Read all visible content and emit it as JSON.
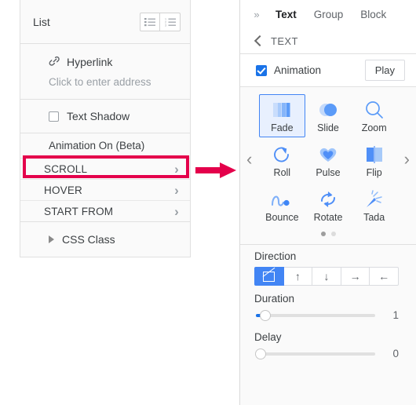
{
  "left_panel": {
    "list_row": {
      "label": "List",
      "bullet_icon": "bulleted-list-icon",
      "numbered_icon": "numbered-list-icon"
    },
    "hyperlink": {
      "icon": "chain-link-icon",
      "label": "Hyperlink",
      "placeholder": "Click to enter address"
    },
    "text_shadow": {
      "label": "Text Shadow",
      "checked": false
    },
    "animation_on_label": "Animation On (Beta)",
    "nav_rows": [
      {
        "label": "SCROLL",
        "highlighted": true
      },
      {
        "label": "HOVER",
        "highlighted": false
      },
      {
        "label": "START FROM",
        "highlighted": false
      }
    ],
    "css_class": {
      "label": "CSS Class",
      "expander_icon": "triangle-right-icon"
    }
  },
  "annotation": {
    "arrow_icon": "red-arrow-right",
    "highlight_color": "#e4004b",
    "target": "SCROLL"
  },
  "right_panel": {
    "expand_icon": "double-chevron-right-icon",
    "tabs": [
      {
        "label": "Text",
        "active": true
      },
      {
        "label": "Group",
        "active": false
      },
      {
        "label": "Block",
        "active": false
      }
    ],
    "back_row": {
      "icon": "back-chevron-icon",
      "label": "TEXT"
    },
    "animation_row": {
      "label": "Animation",
      "checked": true,
      "play_label": "Play"
    },
    "animations": [
      {
        "label": "Fade",
        "icon": "fade-icon",
        "selected": true
      },
      {
        "label": "Slide",
        "icon": "slide-icon",
        "selected": false
      },
      {
        "label": "Zoom",
        "icon": "zoom-icon",
        "selected": false
      },
      {
        "label": "Roll",
        "icon": "roll-icon",
        "selected": false
      },
      {
        "label": "Pulse",
        "icon": "pulse-heart-icon",
        "selected": false
      },
      {
        "label": "Flip",
        "icon": "flip-icon",
        "selected": false
      },
      {
        "label": "Bounce",
        "icon": "bounce-icon",
        "selected": false
      },
      {
        "label": "Rotate",
        "icon": "rotate-icon",
        "selected": false
      },
      {
        "label": "Tada",
        "icon": "tada-icon",
        "selected": false
      }
    ],
    "carousel": {
      "prev_icon": "chevron-left-icon",
      "next_icon": "chevron-right-icon",
      "page_count": 2,
      "active_page": 1
    },
    "direction": {
      "title": "Direction",
      "options": [
        {
          "icon": "no-direction-icon",
          "selected": true
        },
        {
          "icon": "arrow-up-icon",
          "glyph": "↑",
          "selected": false
        },
        {
          "icon": "arrow-down-icon",
          "glyph": "↓",
          "selected": false
        },
        {
          "icon": "arrow-right-icon",
          "glyph": "→",
          "selected": false
        },
        {
          "icon": "arrow-left-icon",
          "glyph": "←",
          "selected": false
        }
      ]
    },
    "duration": {
      "title": "Duration",
      "value": "1",
      "percent": 8
    },
    "delay": {
      "title": "Delay",
      "value": "0",
      "percent": 0
    }
  },
  "colors": {
    "accent_blue": "#1a73e8",
    "icon_blue": "#5b9bf8",
    "annotation_red": "#e4004b"
  }
}
